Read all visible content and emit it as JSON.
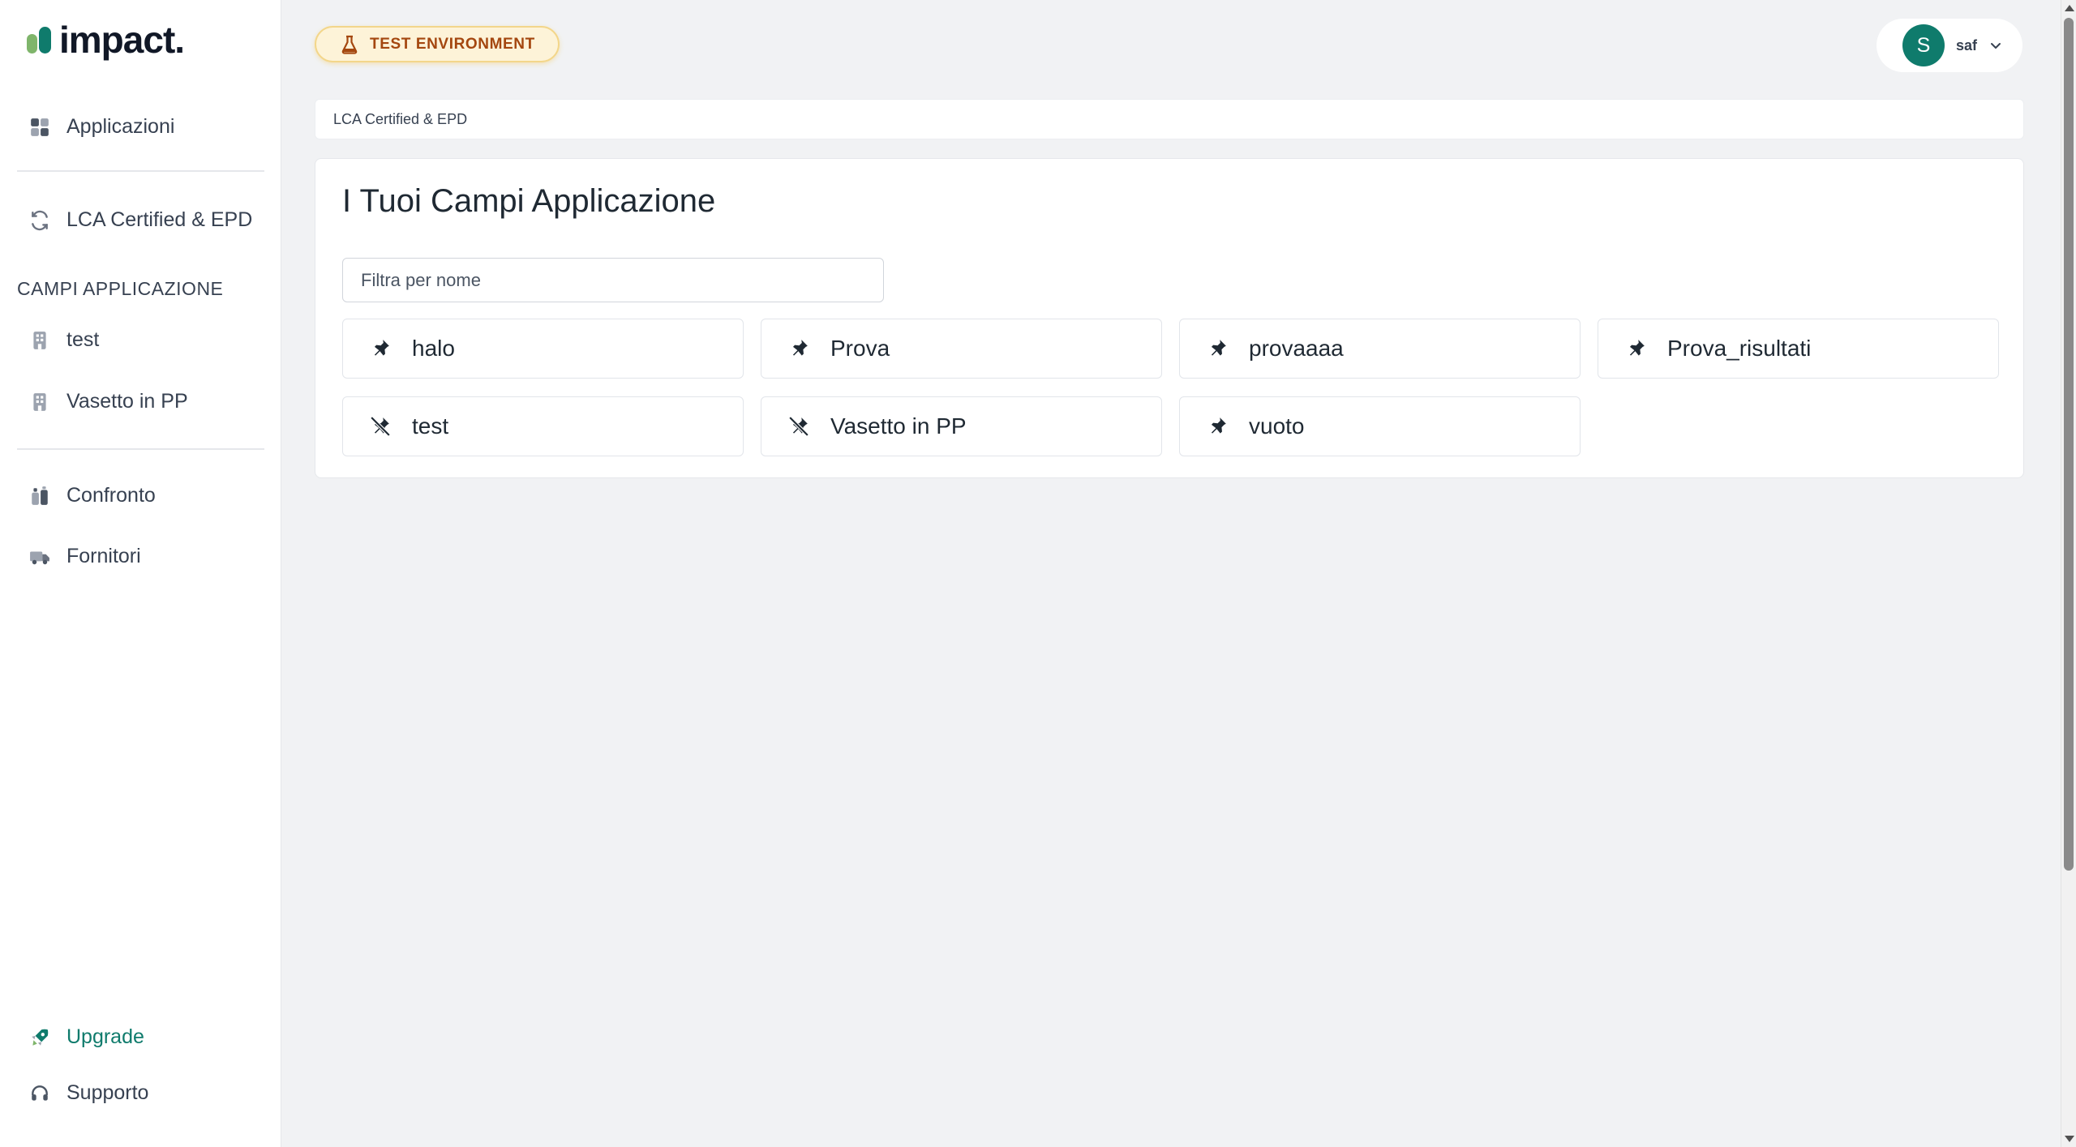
{
  "brand": {
    "logo_text": "impact."
  },
  "sidebar": {
    "applicazioni": "Applicazioni",
    "lca": "LCA Certified & EPD",
    "section_title": "CAMPI APPLICAZIONE",
    "campi": [
      {
        "label": "test",
        "icon": "building-icon"
      },
      {
        "label": "Vasetto in PP",
        "icon": "building-icon"
      }
    ],
    "confronto": "Confronto",
    "fornitori": "Fornitori",
    "upgrade": "Upgrade",
    "supporto": "Supporto"
  },
  "header": {
    "environment_badge": "TEST ENVIRONMENT",
    "user": {
      "initial": "S",
      "name": "saf"
    }
  },
  "breadcrumb": "LCA Certified & EPD",
  "main": {
    "title": "I Tuoi Campi Applicazione",
    "filter_placeholder": "Filtra per nome",
    "tiles": [
      {
        "label": "halo",
        "pinned": true
      },
      {
        "label": "Prova",
        "pinned": true
      },
      {
        "label": "provaaaa",
        "pinned": true
      },
      {
        "label": "Prova_risultati",
        "pinned": true
      },
      {
        "label": "test",
        "pinned": false
      },
      {
        "label": "Vasetto in PP",
        "pinned": false
      },
      {
        "label": "vuoto",
        "pinned": true
      }
    ]
  },
  "colors": {
    "accent": "#0f7b6c",
    "badge_bg": "#fdf3d8",
    "badge_text": "#a4470f",
    "page_bg": "#f1f2f4"
  }
}
